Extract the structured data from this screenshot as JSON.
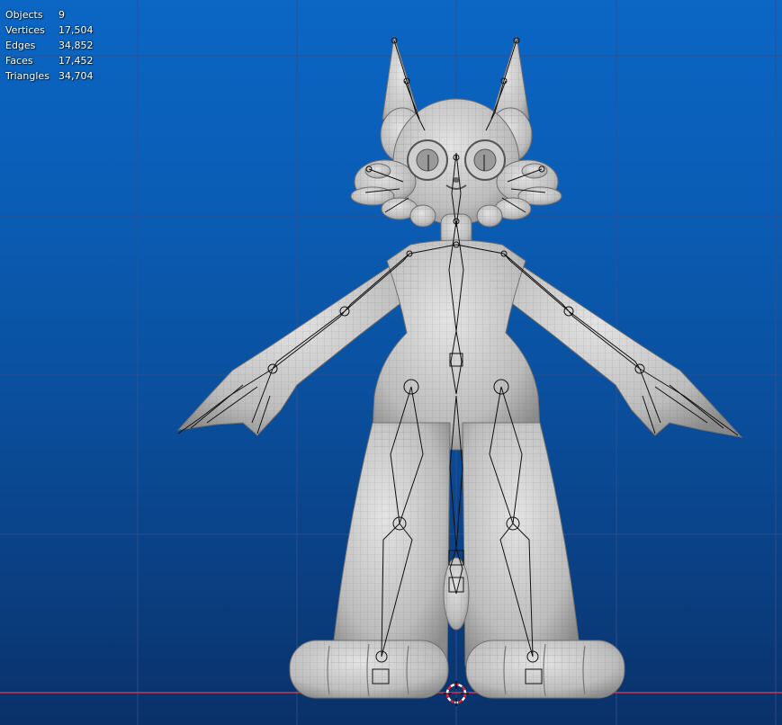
{
  "stats": [
    {
      "label": "Objects",
      "value": "9"
    },
    {
      "label": "Vertices",
      "value": "17,504"
    },
    {
      "label": "Edges",
      "value": "34,852"
    },
    {
      "label": "Faces",
      "value": "17,452"
    },
    {
      "label": "Triangles",
      "value": "34,704"
    }
  ],
  "colors": {
    "background_top": "#0b66c4",
    "background_bottom": "#0a3169",
    "grid": "#35508a",
    "x_axis": "#c43a4e",
    "mesh": "#c8c8c8",
    "wire": "#7d7d7d",
    "bone": "#111111",
    "cursor_red": "#e8222e",
    "cursor_white": "#ffffff"
  },
  "icons": {
    "cursor": "3d-cursor-icon"
  }
}
